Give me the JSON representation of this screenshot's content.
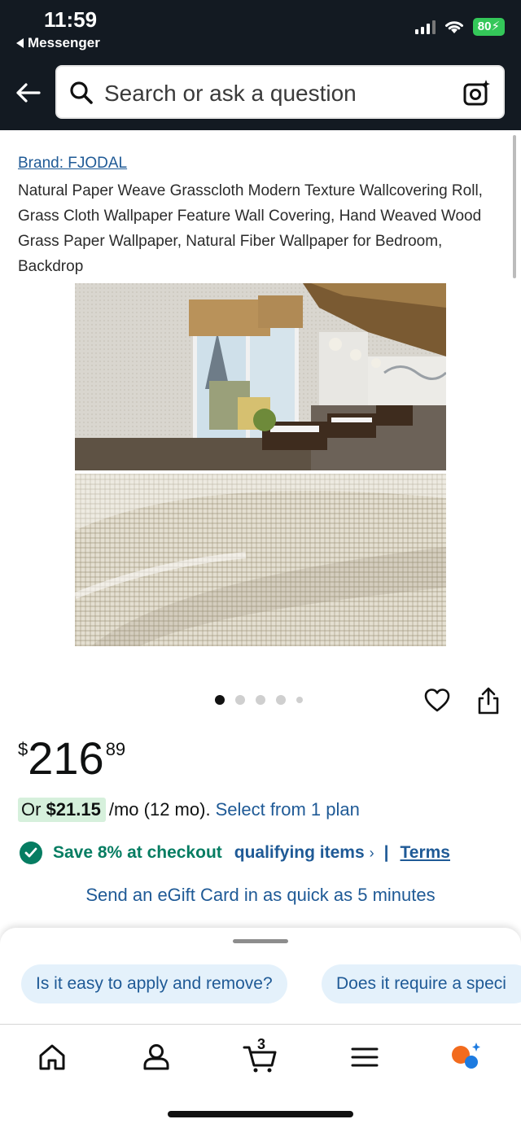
{
  "status_bar": {
    "time": "11:59",
    "back_app": "Messenger",
    "battery": "80"
  },
  "search": {
    "placeholder": "Search or ask a question"
  },
  "product": {
    "brand": "Brand: FJODAL",
    "title": "Natural Paper Weave Grasscloth Modern Texture Wallcovering Roll, Grass Cloth Wallpaper Feature Wall Covering, Hand Weaved Wood Grass Paper Wallpaper, Natural Fiber Wallpaper for Bedroom, Backdrop",
    "image_count": 5,
    "active_image": 1
  },
  "price": {
    "symbol": "$",
    "whole": "216",
    "fraction": "89"
  },
  "monthly": {
    "prefix": "Or ",
    "amount": "$21.15",
    "suffix": "/mo (12 mo).",
    "link": "Select from 1 plan"
  },
  "promo": {
    "save_text": "Save 8% at checkout",
    "qualifying": "qualifying items",
    "chevron": "›",
    "separator": "|",
    "terms": "Terms"
  },
  "egift": "Send an eGift Card in as quick as 5 minutes",
  "questions": [
    "Is it easy to apply and remove?",
    "Does it require a speci"
  ],
  "tabbar": {
    "cart_count": "3"
  },
  "colors": {
    "header_bg": "#131a22",
    "link": "#1f5a96",
    "success": "#067d62",
    "chip_bg": "#e4f1fb"
  }
}
